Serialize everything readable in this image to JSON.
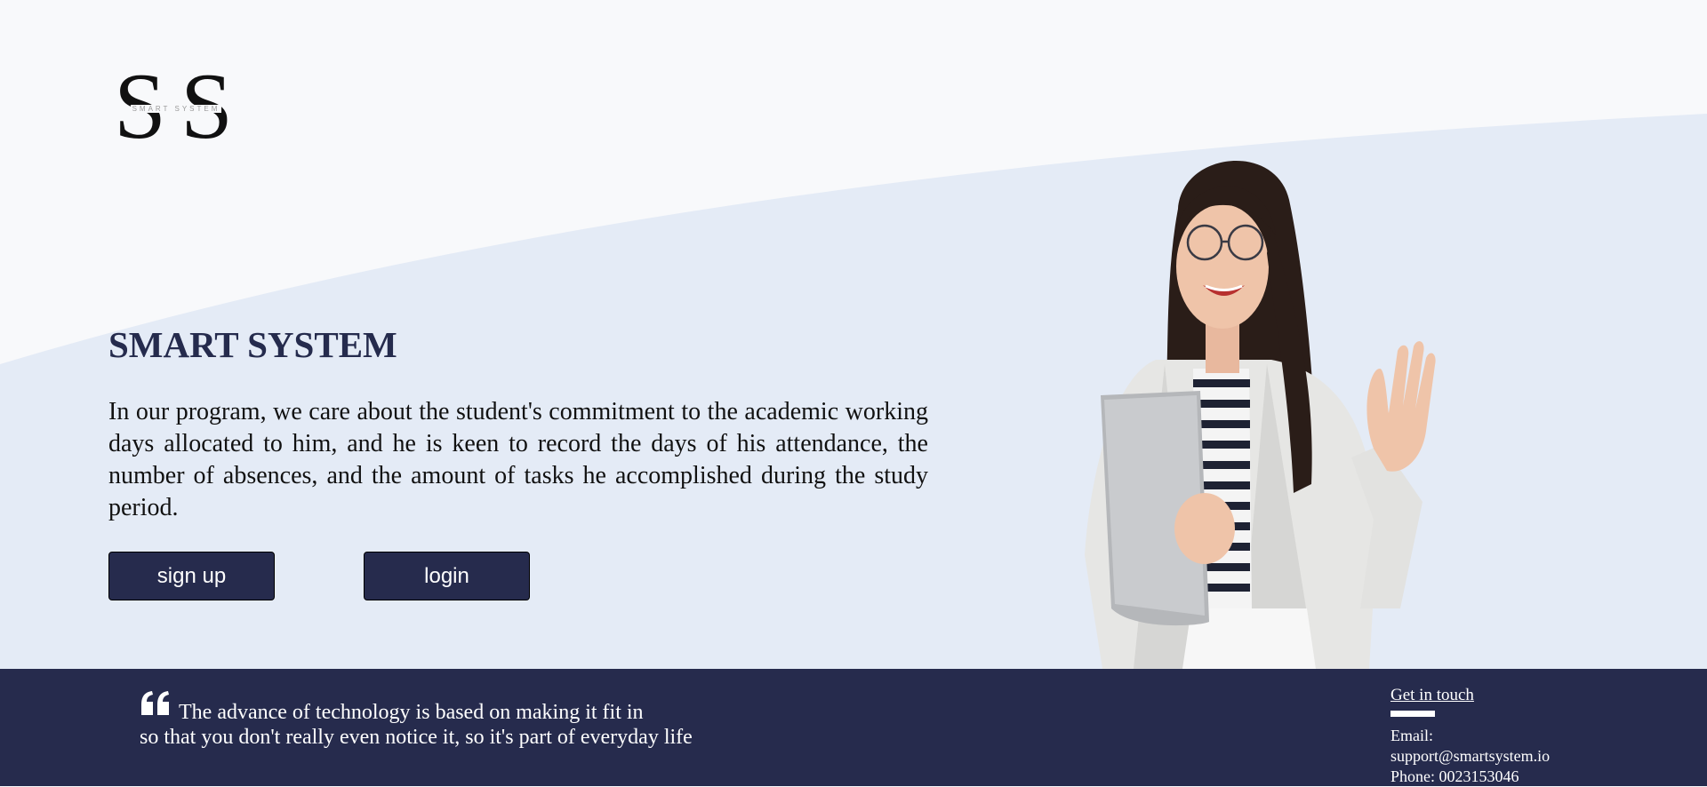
{
  "logo": {
    "letters": "SS",
    "subtitle": "SMART SYSTEM"
  },
  "hero": {
    "title": "SMART SYSTEM",
    "description": "In our program, we care about the student's commitment to the academic working days allocated to him, and he is keen to record the days of his attendance, the number of absences, and the amount of tasks he accomplished during the study period."
  },
  "buttons": {
    "signup": "sign up",
    "login": "login"
  },
  "footer": {
    "quote_line1": "The advance of technology is based on making it fit in",
    "quote_line2": "so that you don't really even notice it, so it's part of everyday life",
    "contact_heading": "Get in touch",
    "email_label": "Email:",
    "email": "support@smartsystem.io",
    "phone": "Phone: 0023153046"
  },
  "icons": {
    "quote": "quote-icon",
    "hero_image": "woman-with-laptop-waving"
  },
  "colors": {
    "navy": "#262b4d",
    "hero_background": "#e4ebf6",
    "page_background": "#f8f9fb",
    "text": "#111111"
  }
}
